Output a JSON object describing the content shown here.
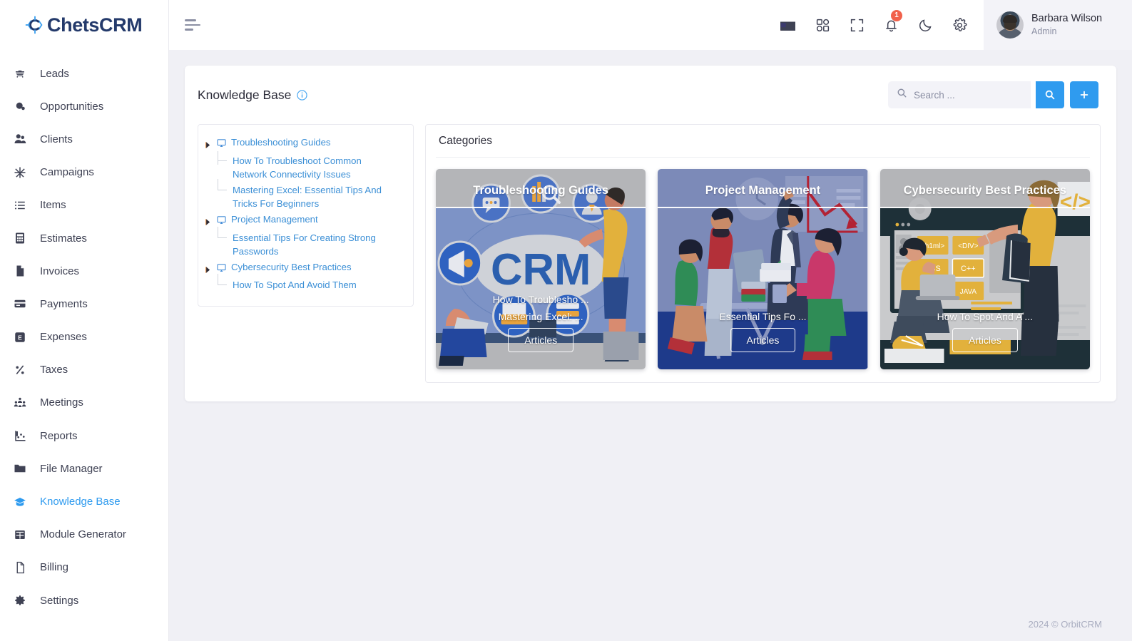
{
  "brand": {
    "name": "ChetsCRM",
    "logo_icon": "chets-logo-icon"
  },
  "sidebar": {
    "items": [
      {
        "label": "Leads",
        "icon": "leads-icon",
        "active": false
      },
      {
        "label": "Opportunities",
        "icon": "opportunities-icon",
        "active": false
      },
      {
        "label": "Clients",
        "icon": "clients-icon",
        "active": false
      },
      {
        "label": "Campaigns",
        "icon": "campaigns-icon",
        "active": false
      },
      {
        "label": "Items",
        "icon": "items-icon",
        "active": false
      },
      {
        "label": "Estimates",
        "icon": "estimates-icon",
        "active": false
      },
      {
        "label": "Invoices",
        "icon": "invoices-icon",
        "active": false
      },
      {
        "label": "Payments",
        "icon": "payments-icon",
        "active": false
      },
      {
        "label": "Expenses",
        "icon": "expenses-icon",
        "active": false
      },
      {
        "label": "Taxes",
        "icon": "taxes-icon",
        "active": false
      },
      {
        "label": "Meetings",
        "icon": "meetings-icon",
        "active": false
      },
      {
        "label": "Reports",
        "icon": "reports-icon",
        "active": false
      },
      {
        "label": "File Manager",
        "icon": "file-manager-icon",
        "active": false
      },
      {
        "label": "Knowledge Base",
        "icon": "knowledge-base-icon",
        "active": true
      },
      {
        "label": "Module Generator",
        "icon": "module-generator-icon",
        "active": false
      },
      {
        "label": "Billing",
        "icon": "billing-icon",
        "active": false
      },
      {
        "label": "Settings",
        "icon": "settings-icon",
        "active": false
      }
    ]
  },
  "topbar": {
    "menu_toggle_icon": "hamburger-icon",
    "icons": [
      {
        "name": "language-flag-icon",
        "label": "US"
      },
      {
        "name": "apps-grid-icon",
        "label": ""
      },
      {
        "name": "fullscreen-icon",
        "label": ""
      },
      {
        "name": "notifications-bell-icon",
        "label": ""
      },
      {
        "name": "dark-mode-moon-icon",
        "label": ""
      },
      {
        "name": "settings-gear-icon",
        "label": ""
      }
    ],
    "notification_count": "1",
    "user": {
      "name": "Barbara Wilson",
      "role": "Admin"
    }
  },
  "page": {
    "title": "Knowledge Base",
    "info_icon": "info-circle-icon",
    "search": {
      "placeholder": "Search ...",
      "value": "",
      "icon": "search-icon"
    },
    "search_button_icon": "search-icon",
    "add_button_icon": "plus-icon"
  },
  "tree": {
    "nodes": [
      {
        "type": "root",
        "label": "Troubleshooting Guides",
        "icon": "monitor-icon"
      },
      {
        "type": "leaf",
        "label": "How To Troubleshoot Common Network Connectivity Issues"
      },
      {
        "type": "leaf",
        "label": "Mastering Excel: Essential Tips And Tricks For Beginners"
      },
      {
        "type": "root",
        "label": "Project Management",
        "icon": "monitor-icon"
      },
      {
        "type": "leaf",
        "label": "Essential Tips For Creating Strong Passwords"
      },
      {
        "type": "root",
        "label": "Cybersecurity Best Practices",
        "icon": "monitor-icon"
      },
      {
        "type": "leaf",
        "label": "How To Spot And Avoid Them"
      }
    ]
  },
  "categories": {
    "heading": "Categories",
    "cards": [
      {
        "title": "Troubleshooting Guides",
        "links": [
          "How To Troublesho ...",
          "Mastering Excel: ..."
        ],
        "button": "Articles",
        "theme": "crm-cloud"
      },
      {
        "title": "Project Management",
        "links": [
          "Essential Tips Fo ..."
        ],
        "button": "Articles",
        "theme": "team-meeting"
      },
      {
        "title": "Cybersecurity Best Practices",
        "links": [
          "How To Spot And A ..."
        ],
        "button": "Articles",
        "theme": "coding-class"
      }
    ]
  },
  "footer": {
    "text": "2024 © OrbitCRM"
  },
  "colors": {
    "accent": "#2f9bef",
    "link": "#3b8fd6",
    "badge": "#f1614b",
    "page_bg": "#f0f0f5",
    "sidebar_bg": "#ffffff",
    "text": "#3f4254"
  }
}
